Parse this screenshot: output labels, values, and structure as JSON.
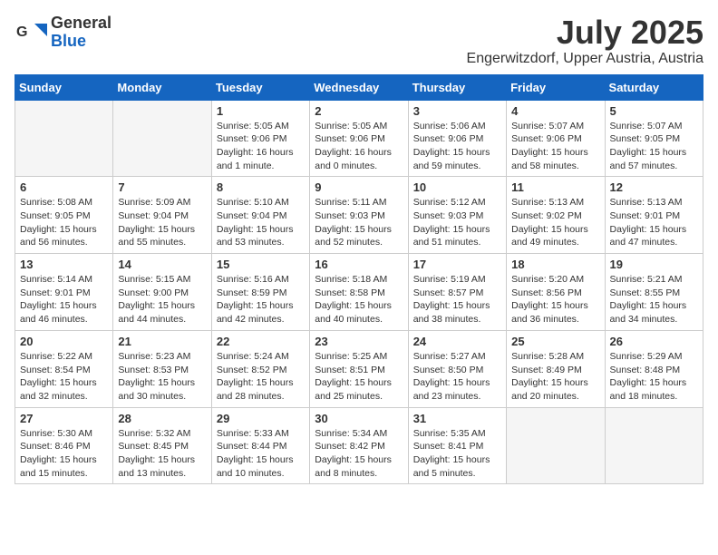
{
  "logo": {
    "general": "General",
    "blue": "Blue"
  },
  "title": "July 2025",
  "location": "Engerwitzdorf, Upper Austria, Austria",
  "days_of_week": [
    "Sunday",
    "Monday",
    "Tuesday",
    "Wednesday",
    "Thursday",
    "Friday",
    "Saturday"
  ],
  "weeks": [
    [
      {
        "day": "",
        "info": ""
      },
      {
        "day": "",
        "info": ""
      },
      {
        "day": "1",
        "info": "Sunrise: 5:05 AM\nSunset: 9:06 PM\nDaylight: 16 hours\nand 1 minute."
      },
      {
        "day": "2",
        "info": "Sunrise: 5:05 AM\nSunset: 9:06 PM\nDaylight: 16 hours\nand 0 minutes."
      },
      {
        "day": "3",
        "info": "Sunrise: 5:06 AM\nSunset: 9:06 PM\nDaylight: 15 hours\nand 59 minutes."
      },
      {
        "day": "4",
        "info": "Sunrise: 5:07 AM\nSunset: 9:06 PM\nDaylight: 15 hours\nand 58 minutes."
      },
      {
        "day": "5",
        "info": "Sunrise: 5:07 AM\nSunset: 9:05 PM\nDaylight: 15 hours\nand 57 minutes."
      }
    ],
    [
      {
        "day": "6",
        "info": "Sunrise: 5:08 AM\nSunset: 9:05 PM\nDaylight: 15 hours\nand 56 minutes."
      },
      {
        "day": "7",
        "info": "Sunrise: 5:09 AM\nSunset: 9:04 PM\nDaylight: 15 hours\nand 55 minutes."
      },
      {
        "day": "8",
        "info": "Sunrise: 5:10 AM\nSunset: 9:04 PM\nDaylight: 15 hours\nand 53 minutes."
      },
      {
        "day": "9",
        "info": "Sunrise: 5:11 AM\nSunset: 9:03 PM\nDaylight: 15 hours\nand 52 minutes."
      },
      {
        "day": "10",
        "info": "Sunrise: 5:12 AM\nSunset: 9:03 PM\nDaylight: 15 hours\nand 51 minutes."
      },
      {
        "day": "11",
        "info": "Sunrise: 5:13 AM\nSunset: 9:02 PM\nDaylight: 15 hours\nand 49 minutes."
      },
      {
        "day": "12",
        "info": "Sunrise: 5:13 AM\nSunset: 9:01 PM\nDaylight: 15 hours\nand 47 minutes."
      }
    ],
    [
      {
        "day": "13",
        "info": "Sunrise: 5:14 AM\nSunset: 9:01 PM\nDaylight: 15 hours\nand 46 minutes."
      },
      {
        "day": "14",
        "info": "Sunrise: 5:15 AM\nSunset: 9:00 PM\nDaylight: 15 hours\nand 44 minutes."
      },
      {
        "day": "15",
        "info": "Sunrise: 5:16 AM\nSunset: 8:59 PM\nDaylight: 15 hours\nand 42 minutes."
      },
      {
        "day": "16",
        "info": "Sunrise: 5:18 AM\nSunset: 8:58 PM\nDaylight: 15 hours\nand 40 minutes."
      },
      {
        "day": "17",
        "info": "Sunrise: 5:19 AM\nSunset: 8:57 PM\nDaylight: 15 hours\nand 38 minutes."
      },
      {
        "day": "18",
        "info": "Sunrise: 5:20 AM\nSunset: 8:56 PM\nDaylight: 15 hours\nand 36 minutes."
      },
      {
        "day": "19",
        "info": "Sunrise: 5:21 AM\nSunset: 8:55 PM\nDaylight: 15 hours\nand 34 minutes."
      }
    ],
    [
      {
        "day": "20",
        "info": "Sunrise: 5:22 AM\nSunset: 8:54 PM\nDaylight: 15 hours\nand 32 minutes."
      },
      {
        "day": "21",
        "info": "Sunrise: 5:23 AM\nSunset: 8:53 PM\nDaylight: 15 hours\nand 30 minutes."
      },
      {
        "day": "22",
        "info": "Sunrise: 5:24 AM\nSunset: 8:52 PM\nDaylight: 15 hours\nand 28 minutes."
      },
      {
        "day": "23",
        "info": "Sunrise: 5:25 AM\nSunset: 8:51 PM\nDaylight: 15 hours\nand 25 minutes."
      },
      {
        "day": "24",
        "info": "Sunrise: 5:27 AM\nSunset: 8:50 PM\nDaylight: 15 hours\nand 23 minutes."
      },
      {
        "day": "25",
        "info": "Sunrise: 5:28 AM\nSunset: 8:49 PM\nDaylight: 15 hours\nand 20 minutes."
      },
      {
        "day": "26",
        "info": "Sunrise: 5:29 AM\nSunset: 8:48 PM\nDaylight: 15 hours\nand 18 minutes."
      }
    ],
    [
      {
        "day": "27",
        "info": "Sunrise: 5:30 AM\nSunset: 8:46 PM\nDaylight: 15 hours\nand 15 minutes."
      },
      {
        "day": "28",
        "info": "Sunrise: 5:32 AM\nSunset: 8:45 PM\nDaylight: 15 hours\nand 13 minutes."
      },
      {
        "day": "29",
        "info": "Sunrise: 5:33 AM\nSunset: 8:44 PM\nDaylight: 15 hours\nand 10 minutes."
      },
      {
        "day": "30",
        "info": "Sunrise: 5:34 AM\nSunset: 8:42 PM\nDaylight: 15 hours\nand 8 minutes."
      },
      {
        "day": "31",
        "info": "Sunrise: 5:35 AM\nSunset: 8:41 PM\nDaylight: 15 hours\nand 5 minutes."
      },
      {
        "day": "",
        "info": ""
      },
      {
        "day": "",
        "info": ""
      }
    ]
  ]
}
